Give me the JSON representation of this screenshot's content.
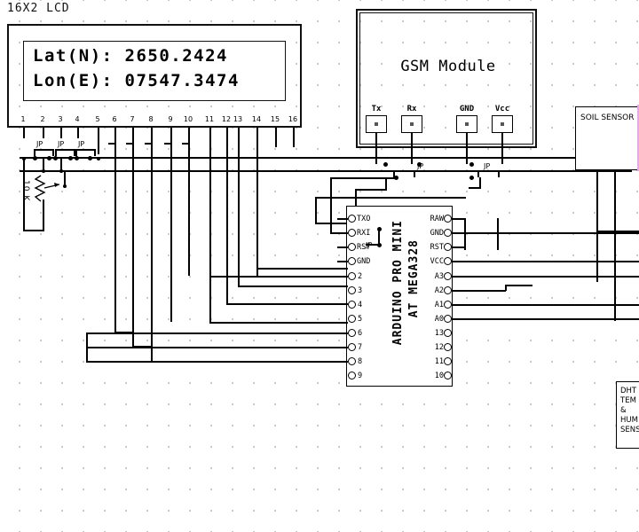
{
  "diagram": {
    "title_lcd": "16X2 LCD",
    "background": "#ffffff",
    "wire_color": "#000000"
  },
  "lcd": {
    "label": "16X2 LCD",
    "line1": "Lat(N): 2650.2424",
    "line2": "Lon(E): 07547.3474",
    "pin_numbers": [
      "1",
      "2",
      "3",
      "4",
      "5",
      "6",
      "7",
      "8",
      "9",
      "10",
      "11",
      "12",
      "13",
      "14",
      "15",
      "16"
    ]
  },
  "potentiometer": {
    "value": "10 K",
    "type": "trimpot"
  },
  "jumpers": {
    "label": "JP",
    "count_lcd": 3,
    "count_gsm": 2,
    "count_arduino": 1
  },
  "gsm": {
    "title": "GSM Module",
    "pins": [
      "Tx",
      "Rx",
      "GND",
      "Vcc"
    ]
  },
  "arduino": {
    "title_line1": "ARDUINO PRO MINI",
    "title_line2": "AT MEGA328",
    "pins_left": [
      "TXO",
      "RXI",
      "RST",
      "GND",
      "2",
      "3",
      "4",
      "5",
      "6",
      "7",
      "8",
      "9"
    ],
    "pins_right": [
      "RAW",
      "GND",
      "RST",
      "VCC",
      "A3",
      "A2",
      "A1",
      "A0",
      "13",
      "12",
      "11",
      "10"
    ]
  },
  "soil_sensor": {
    "label": "SOIL SENSOR"
  },
  "dht_sensor": {
    "line1": "DHT",
    "line2": "TEM",
    "line3": "&",
    "line4": "HUM",
    "line5": "SENS"
  }
}
